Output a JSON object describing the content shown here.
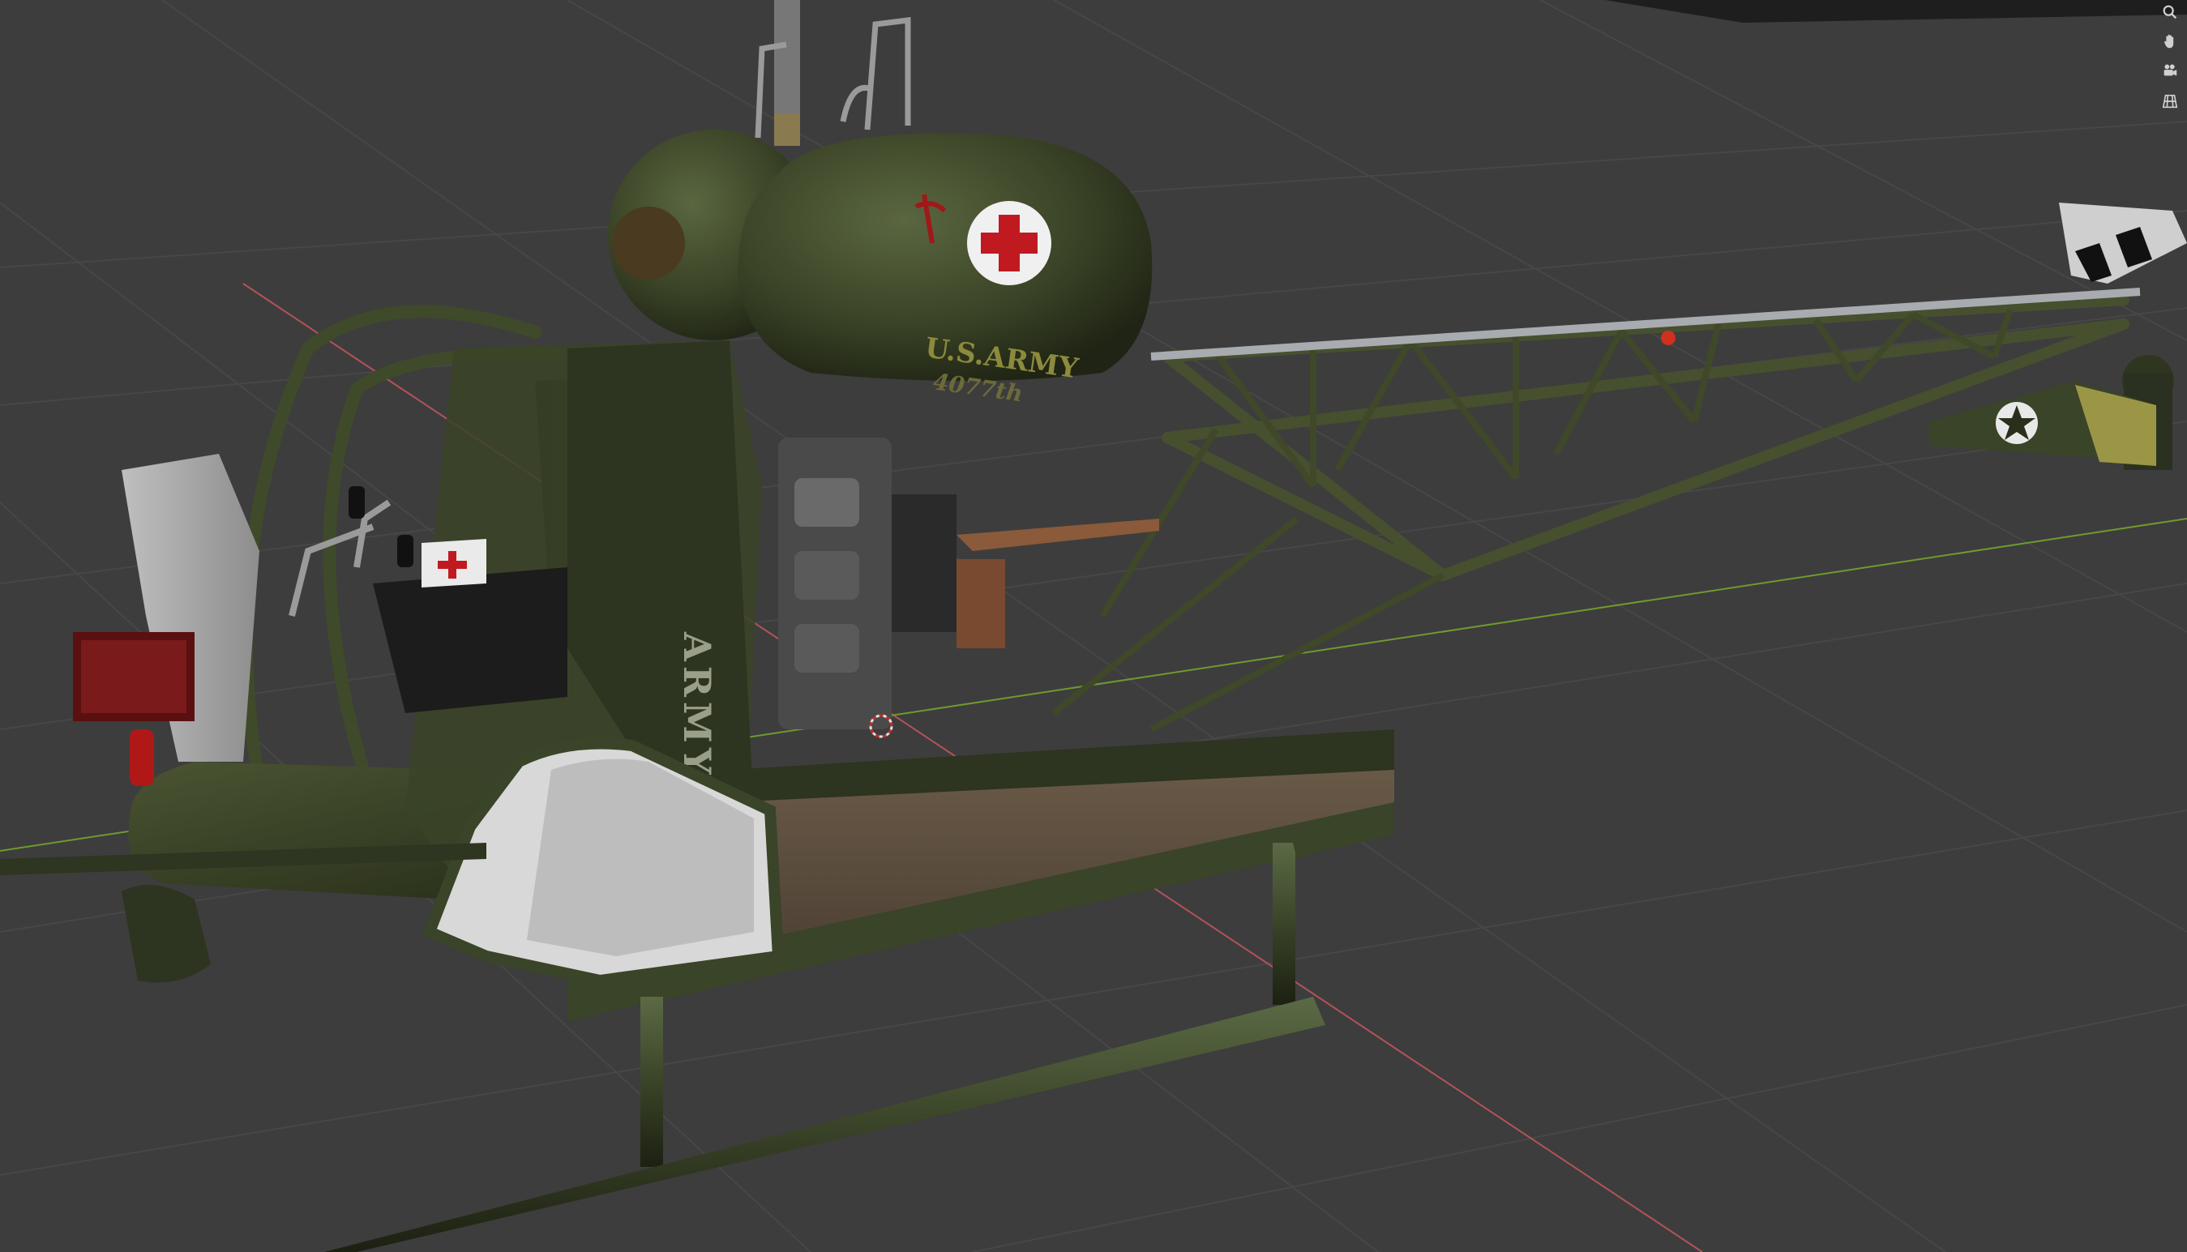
{
  "app": {
    "editor": "3D Viewport"
  },
  "colors": {
    "background": "#3d3d3d",
    "grid_line": "#4a4a4a",
    "x_axis": "#b5525a",
    "y_axis": "#6f9a2e",
    "olive": "#3c4428",
    "olive_dark": "#262c18",
    "olive_light": "#56603a",
    "red_cross": "#c01a20",
    "canvas_tan": "#5b4d3e"
  },
  "aircraft": {
    "tank_text_line1": "U.S.ARMY",
    "tank_text_line2": "4077th",
    "fuselage_text": "ARMY",
    "red_cross_symbol": "+",
    "insignia": "star-insignia"
  },
  "navigation": {
    "zoom_icon": "zoom-magnifier-icon",
    "pan_icon": "pan-hand-icon",
    "camera_icon": "camera-view-icon",
    "ortho_icon": "ortho-grid-icon"
  }
}
